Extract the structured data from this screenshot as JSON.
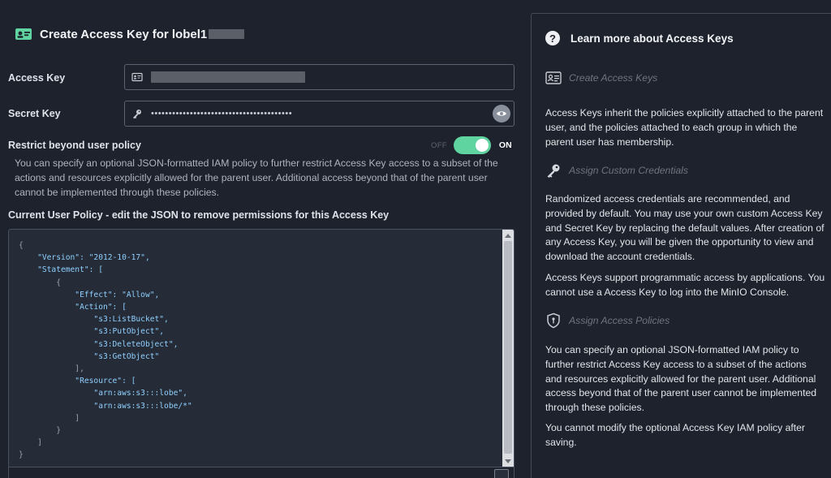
{
  "form": {
    "title": "Create Access Key for lobel1",
    "access_key": {
      "label": "Access Key"
    },
    "secret_key": {
      "label": "Secret Key",
      "value": "••••••••••••••••••••••••••••••••••••••••"
    },
    "restrict": {
      "label": "Restrict beyond user policy",
      "toggle_off": "OFF",
      "toggle_on": "ON",
      "toggle_state": true,
      "description": "You can specify an optional JSON-formatted IAM policy to further restrict Access Key access to a subset of the actions and resources explicitly allowed for the parent user. Additional access beyond that of the parent user cannot be implemented through these policies."
    },
    "policy": {
      "label": "Current User Policy - edit the JSON to remove permissions for this Access Key",
      "lines": [
        "{",
        "    \"Version\": \"2012-10-17\",",
        "    \"Statement\": [",
        "        {",
        "            \"Effect\": \"Allow\",",
        "            \"Action\": [",
        "                \"s3:ListBucket\",",
        "                \"s3:PutObject\",",
        "                \"s3:DeleteObject\",",
        "                \"s3:GetObject\"",
        "            ],",
        "            \"Resource\": [",
        "                \"arn:aws:s3:::lobe\",",
        "                \"arn:aws:s3:::lobe/*\"",
        "            ]",
        "        }",
        "    ]",
        "}"
      ]
    }
  },
  "help": {
    "title": "Learn more about Access Keys",
    "sections": [
      {
        "title": "Create Access Keys",
        "icon": "id-card-icon"
      },
      {
        "text": "Access Keys inherit the policies explicitly attached to the parent user, and the policies attached to each group in which the parent user has membership."
      },
      {
        "title": "Assign Custom Credentials",
        "icon": "key-icon"
      },
      {
        "text": "Randomized access credentials are recommended, and provided by default. You may use your own custom Access Key and Secret Key by replacing the default values. After creation of any Access Key, you will be given the opportunity to view and download the account credentials."
      },
      {
        "text": "Access Keys support programmatic access by applications. You cannot use a Access Key to log into the MinIO Console."
      },
      {
        "title": "Assign Access Policies",
        "icon": "shield-icon"
      },
      {
        "text": "You can specify an optional JSON-formatted IAM policy to further restrict Access Key access to a subset of the actions and resources explicitly allowed for the parent user. Additional access beyond that of the parent user cannot be implemented through these policies."
      },
      {
        "text": "You cannot modify the optional Access Key IAM policy after saving."
      }
    ]
  },
  "colors": {
    "toggle_on": "#5fd3a0",
    "background": "#1e222c",
    "code_text": "#8fd0ff"
  }
}
